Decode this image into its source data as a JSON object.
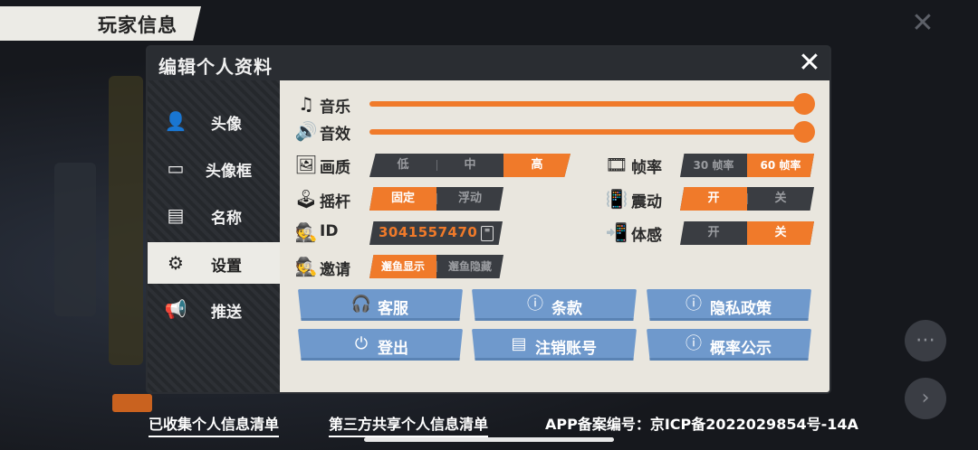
{
  "screen_title": "玩家信息",
  "panel": {
    "title": "编辑个人资料",
    "close_glyph": "✕"
  },
  "sidebar": {
    "items": [
      {
        "label": "头像",
        "icon": "avatar-icon",
        "active": false
      },
      {
        "label": "头像框",
        "icon": "frame-icon",
        "active": false
      },
      {
        "label": "名称",
        "icon": "id-card-icon",
        "active": false
      },
      {
        "label": "设置",
        "icon": "gear-icon",
        "active": true
      },
      {
        "label": "推送",
        "icon": "megaphone-icon",
        "active": false
      }
    ]
  },
  "settings": {
    "music": {
      "label": "音乐",
      "icon": "music-note-icon",
      "value": 1.0
    },
    "sfx": {
      "label": "音效",
      "icon": "speaker-icon",
      "value": 1.0
    },
    "quality": {
      "label": "画质",
      "icon": "image-icon",
      "options": [
        "低",
        "中",
        "高"
      ],
      "selected": "高"
    },
    "joystick": {
      "label": "摇杆",
      "icon": "joystick-icon",
      "options": [
        "固定",
        "浮动"
      ],
      "selected": "固定"
    },
    "id": {
      "label": "ID",
      "icon": "agent-icon",
      "value": "3041557470"
    },
    "invite": {
      "label": "邀请",
      "icon": "invite-icon",
      "options": [
        "邂鱼显示",
        "邂鱼隐藏"
      ],
      "selected": "邂鱼显示"
    },
    "framerate": {
      "label": "帧率",
      "icon": "film-icon",
      "options": [
        "30 帧率",
        "60 帧率"
      ],
      "selected": "60 帧率"
    },
    "vibration": {
      "label": "震动",
      "icon": "vibrate-icon",
      "options": [
        "开",
        "关"
      ],
      "selected": "开"
    },
    "motion": {
      "label": "体感",
      "icon": "motion-icon",
      "options": [
        "开",
        "关"
      ],
      "selected": "关"
    }
  },
  "buttons": [
    {
      "label": "客服",
      "icon": "headset-icon"
    },
    {
      "label": "条款",
      "icon": "shield-info-icon"
    },
    {
      "label": "隐私政策",
      "icon": "shield-info-icon"
    },
    {
      "label": "登出",
      "icon": "power-icon"
    },
    {
      "label": "注销账号",
      "icon": "id-card-icon"
    },
    {
      "label": "概率公示",
      "icon": "shield-info-icon"
    }
  ],
  "footer": {
    "collected_info": "已收集个人信息清单",
    "shared_info": "第三方共享个人信息清单",
    "icp": "APP备案编号：京ICP备2022029854号-14A"
  },
  "colors": {
    "accent": "#f07a2a",
    "button": "#6f99cc",
    "dark": "#2a2d32",
    "panel": "#e9e6de"
  }
}
